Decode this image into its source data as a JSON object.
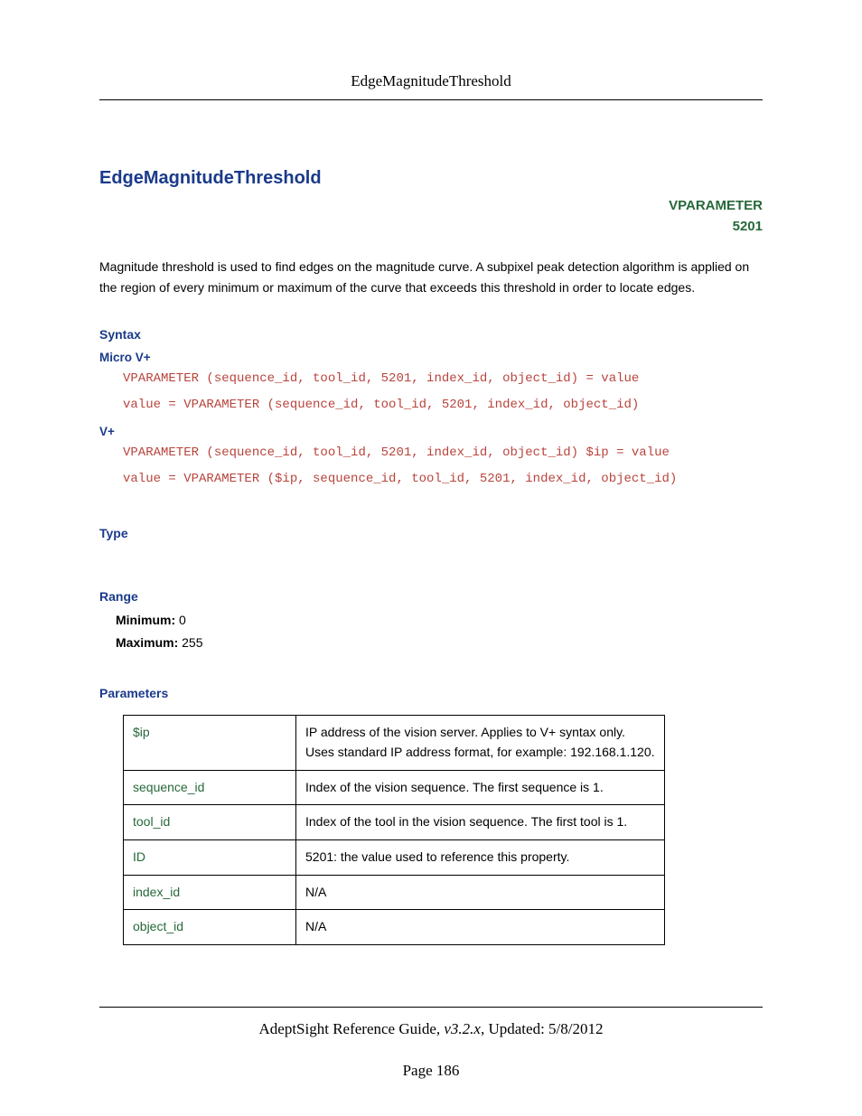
{
  "runningHead": "EdgeMagnitudeThreshold",
  "title": "EdgeMagnitudeThreshold",
  "vparamLabel": "VPARAMETER",
  "vparamNumber": "5201",
  "description": "Magnitude threshold is used to find edges on the magnitude curve. A subpixel peak detection algorithm is applied on the region of every minimum or maximum of the curve that exceeds this threshold in order to locate edges.",
  "sections": {
    "syntax": "Syntax",
    "microV": "Micro V+",
    "vplus": "V+",
    "type": "Type",
    "range": "Range",
    "parameters": "Parameters"
  },
  "code": {
    "micro1": "VPARAMETER (sequence_id, tool_id, 5201, index_id, object_id) = value",
    "micro2": "value = VPARAMETER (sequence_id, tool_id, 5201, index_id, object_id)",
    "vplus1": "VPARAMETER (sequence_id, tool_id, 5201, index_id, object_id) $ip = value",
    "vplus2": "value = VPARAMETER ($ip, sequence_id, tool_id, 5201, index_id, object_id)"
  },
  "range": {
    "minLabel": "Minimum:",
    "minValue": "0",
    "maxLabel": "Maximum:",
    "maxValue": "255"
  },
  "paramsTable": [
    {
      "name": "$ip",
      "desc": "IP address of the vision server. Applies to V+ syntax only. Uses standard IP address format, for example: 192.168.1.120."
    },
    {
      "name": "sequence_id",
      "desc": "Index of the vision sequence. The first sequence is 1."
    },
    {
      "name": "tool_id",
      "desc": "Index of the tool in the vision sequence. The first tool is 1."
    },
    {
      "name": "ID",
      "desc": "5201: the value used to reference this property."
    },
    {
      "name": "index_id",
      "desc": "N/A"
    },
    {
      "name": "object_id",
      "desc": "N/A"
    }
  ],
  "footer": {
    "guide": "AdeptSight Reference Guide",
    "version": ", v3.2.x",
    "updated": ", Updated: 5/8/2012",
    "page": "Page 186"
  }
}
